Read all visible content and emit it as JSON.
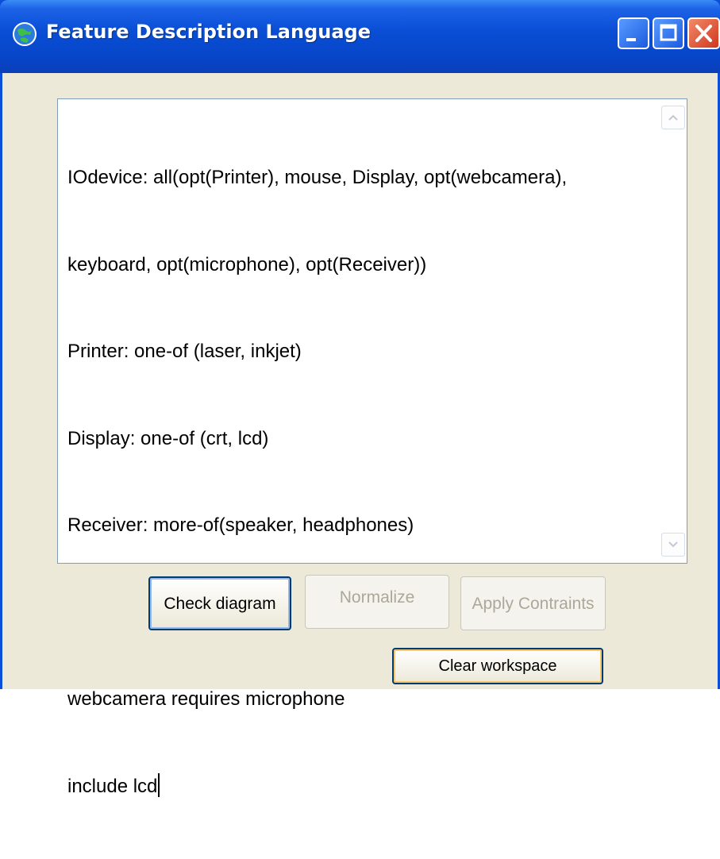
{
  "window": {
    "title": "Feature Description Language",
    "icon": "globe-app-icon",
    "controls": [
      "minimize-icon",
      "maximize-icon",
      "close-icon"
    ]
  },
  "editor": {
    "lines": [
      "IOdevice: all(opt(Printer), mouse, Display, opt(webcamera),",
      "keyboard, opt(microphone), opt(Receiver))",
      "Printer: one-of (laser, inkjet)",
      "Display: one-of (crt, lcd)",
      "Receiver: more-of(speaker, headphones)",
      "",
      "webcamera requires microphone",
      "include lcd"
    ]
  },
  "buttons": {
    "check": "Check diagram",
    "normalize": "Normalize",
    "apply": "Apply Contraints",
    "clear": "Clear workspace"
  },
  "colors": {
    "titlebar": "#0a4fd6",
    "client_bg": "#ece9d8",
    "disabled_text": "#aca899",
    "focus_border": "#003c74"
  }
}
